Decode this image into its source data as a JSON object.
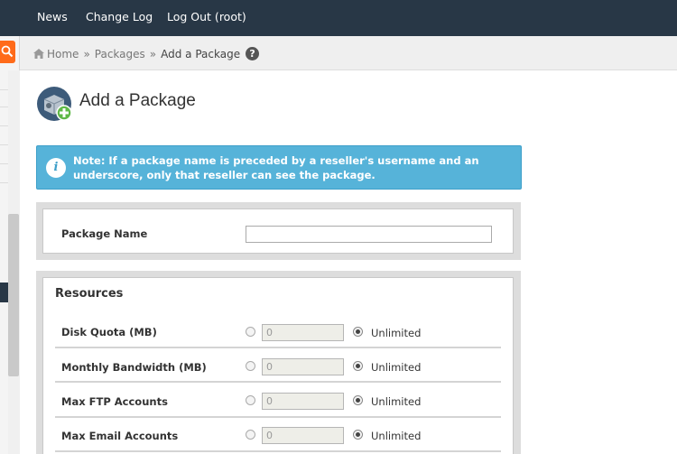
{
  "topnav": {
    "items": [
      "News",
      "Change Log",
      "Log Out (root)"
    ]
  },
  "breadcrumb": {
    "home": "Home",
    "separator": "»",
    "packages": "Packages",
    "current": "Add a Package",
    "help_icon": "?"
  },
  "page": {
    "title": "Add a Package",
    "icon": "package-add-icon"
  },
  "note": {
    "icon": "i",
    "text": "Note: If a package name is preceded by a reseller's username and an underscore, only that reseller can see the package."
  },
  "package_name": {
    "label": "Package Name",
    "value": ""
  },
  "resources": {
    "title": "Resources",
    "unlimited_label": "Unlimited",
    "rows": [
      {
        "label": "Disk Quota (MB)",
        "value": "0",
        "unlimited": true
      },
      {
        "label": "Monthly Bandwidth (MB)",
        "value": "0",
        "unlimited": true
      },
      {
        "label": "Max FTP Accounts",
        "value": "0",
        "unlimited": true
      },
      {
        "label": "Max Email Accounts",
        "value": "0",
        "unlimited": true
      }
    ]
  },
  "colors": {
    "topbar": "#283746",
    "note_bg": "#56b3d9",
    "search_accent": "#ff6b1a"
  }
}
